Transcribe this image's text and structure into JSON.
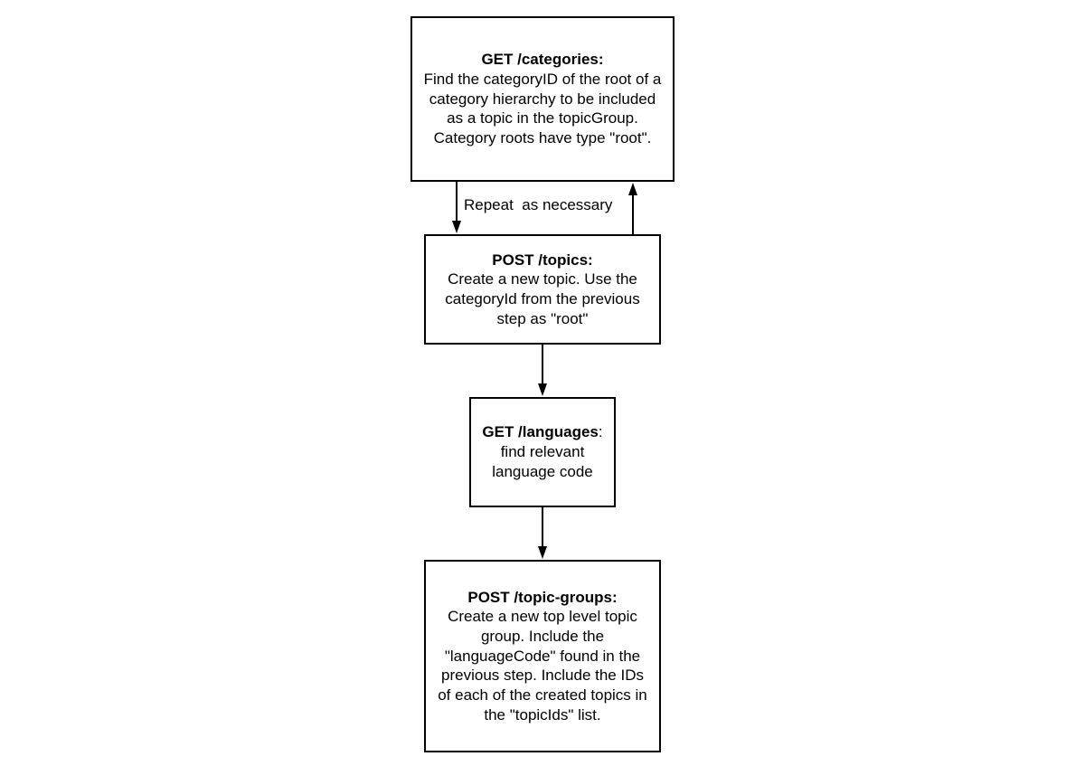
{
  "nodes": {
    "categories": {
      "title": "GET /categories:",
      "lines": [
        "Find the categoryID of the root of a",
        "category hierarchy to be included",
        "as a topic in the topicGroup.",
        "Category roots have type \"root\"."
      ]
    },
    "topics": {
      "title": "POST /topics:",
      "lines": [
        "Create a new topic. Use the",
        "categoryId from the previous",
        "step as \"root\""
      ]
    },
    "languages": {
      "title": "GET /languages",
      "title_suffix": ":",
      "lines": [
        "find relevant",
        "language code"
      ]
    },
    "topic_groups": {
      "title": "POST /topic-groups:",
      "lines": [
        "Create a new top level topic",
        "group. Include the",
        "\"languageCode\" found in the",
        "previous step. Include the IDs",
        "of each of the created topics in",
        "the \"topicIds\" list."
      ]
    }
  },
  "edges": {
    "loop_label": "Repeat  as necessary"
  }
}
